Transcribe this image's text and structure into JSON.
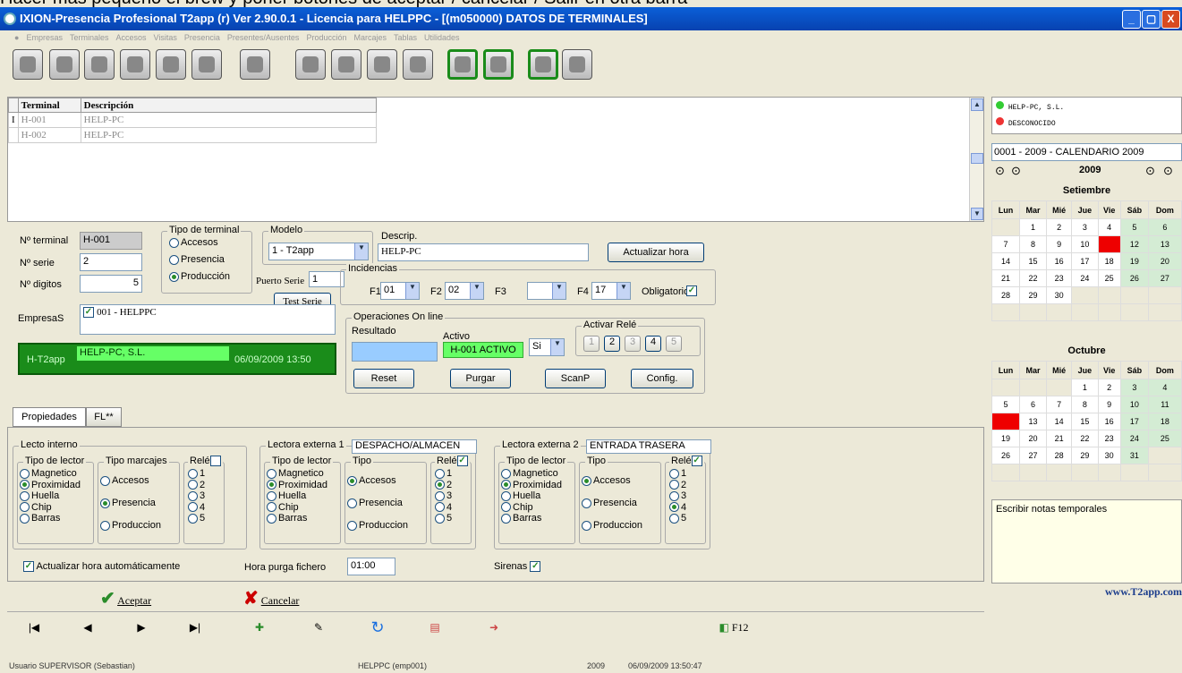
{
  "top_note": "Hacer más pequeño el brew y poner botones de aceptar / cancelar / Salir en otra barra",
  "window": {
    "title": "IXION-Presencia Profesional T2app (r) Ver 2.90.0.1  -  Licencia para HELPPC - [(m050000)  DATOS DE TERMINALES]",
    "min": "_",
    "max": "▢",
    "close": "X"
  },
  "menu": [
    "Empresas",
    "Terminales",
    "Accesos",
    "Visitas",
    "Presencia",
    "Presentes/Ausentes",
    "Producción",
    "Marcajes",
    "Tablas",
    "Utilidades"
  ],
  "toolbar_icons": [
    "users-icon",
    "keys-icon",
    "tools-icon",
    "settings-gear-icon",
    "calculator-icon",
    "printer-icon",
    "compass-icon",
    "document-search-icon",
    "user-edit-icon",
    "calendar-icon",
    "clock-icon",
    "help-icon",
    "info-icon",
    "notes-icon",
    "power-icon"
  ],
  "grid": {
    "headers": [
      "Terminal",
      "Descripción"
    ],
    "rows": [
      [
        "H-001",
        "HELP-PC"
      ],
      [
        "H-002",
        "HELP-PC"
      ]
    ],
    "row_marker": "I"
  },
  "form": {
    "terminal_label": "Nº terminal",
    "terminal_value": "H-001",
    "serie_label": "Nº serie",
    "serie_value": "2",
    "digitos_label": "Nº digitos",
    "digitos_value": "5",
    "empresas_label": "EmpresaS",
    "empresa_item": "001 - HELPPC",
    "tipo_terminal": {
      "title": "Tipo de terminal",
      "options": [
        "Accesos",
        "Presencia",
        "Producción"
      ],
      "selected": 2
    },
    "modelo": {
      "title": "Modelo",
      "value": "1 - T2app"
    },
    "puerto_label": "Puerto Serie",
    "puerto_value": "1",
    "test_serie": "Test Serie",
    "descrip_label": "Descrip.",
    "descrip_value": "HELP-PC",
    "actualizar_hora": "Actualizar hora",
    "incidencias": {
      "title": "Incidencias",
      "f1_label": "F1",
      "f1": "01",
      "f2_label": "F2",
      "f2": "02",
      "f3_label": "F3",
      "f3": "",
      "f4_label": "F4",
      "f4": "17",
      "obligatorio": "Obligatorio"
    },
    "banner": {
      "left": "H-T2app",
      "name": "HELP-PC, S.L.",
      "date": "06/09/2009 13:50"
    },
    "operaciones": {
      "title": "Operaciones On line",
      "resultado": "Resultado",
      "activo_label": "Activo",
      "activo_value": "H-001 ACTIVO",
      "si": "Si",
      "rele_title": "Activar Relé",
      "reles": [
        "1",
        "2",
        "3",
        "4",
        "5"
      ],
      "buttons": [
        "Reset",
        "Purgar",
        "ScanP",
        "Config."
      ]
    }
  },
  "tabs": [
    "Propiedades",
    "FL**"
  ],
  "lecto_interno": {
    "title": "Lecto interno",
    "tipo_lector": "Tipo de lector",
    "lector_opts": [
      "Magnetico",
      "Proximidad",
      "Huella",
      "Chip",
      "Barras"
    ],
    "lector_sel": 1,
    "tipo_marcajes": "Tipo marcajes",
    "marc_opts": [
      "Accesos",
      "Presencia",
      "Produccion"
    ],
    "marc_sel": 1,
    "rele": "Relé",
    "rele_opts": [
      "1",
      "2",
      "3",
      "4",
      "5"
    ],
    "rele_sel": -1
  },
  "lectora1": {
    "title": "Lectora externa 1",
    "name": "DESPACHO/ALMACEN",
    "tipo_lector": "Tipo de lector",
    "lector_opts": [
      "Magnetico",
      "Proximidad",
      "Huella",
      "Chip",
      "Barras"
    ],
    "lector_sel": 1,
    "tipo": "Tipo",
    "marc_opts": [
      "Accesos",
      "Presencia",
      "Produccion"
    ],
    "marc_sel": 0,
    "rele": "Relé",
    "rele_opts": [
      "1",
      "2",
      "3",
      "4",
      "5"
    ],
    "rele_sel": 1
  },
  "lectora2": {
    "title": "Lectora externa 2",
    "name": "ENTRADA TRASERA",
    "tipo_lector": "Tipo de lector",
    "lector_opts": [
      "Magnetico",
      "Proximidad",
      "Huella",
      "Chip",
      "Barras"
    ],
    "lector_sel": 1,
    "tipo": "Tipo",
    "marc_opts": [
      "Accesos",
      "Presencia",
      "Produccion"
    ],
    "marc_sel": 0,
    "rele": "Relé",
    "rele_opts": [
      "1",
      "2",
      "3",
      "4",
      "5"
    ],
    "rele_sel": 3
  },
  "bottom_opts": {
    "actualizar": "Actualizar hora automáticamente",
    "hora_purga_label": "Hora purga fichero",
    "hora_purga": "01:00",
    "sirenas": "Sirenas"
  },
  "actions": {
    "aceptar": "Aceptar",
    "cancelar": "Cancelar"
  },
  "nav": {
    "first": "|◀",
    "prev": "◀",
    "next": "▶",
    "last": "▶|",
    "f12": "F12"
  },
  "status": {
    "user": "Usuario SUPERVISOR (Sebastian)",
    "host": "HELPPC  (emp001)",
    "year": "2009",
    "datetime": "06/09/2009 13:50:47"
  },
  "right": {
    "companies": [
      "HELP-PC, S.L.",
      "DESCONOCIDO"
    ],
    "calendar_select": "0001 - 2009 - CALENDARIO 2009",
    "year": "2009",
    "weekdays": [
      "Lun",
      "Mar",
      "Mié",
      "Jue",
      "Vie",
      "Sáb",
      "Dom"
    ],
    "months": [
      {
        "name": "Setiembre",
        "weeks": [
          [
            "",
            "1",
            "2",
            "3",
            "4",
            "5",
            "6"
          ],
          [
            "7",
            "8",
            "9",
            "10",
            "11",
            "12",
            "13"
          ],
          [
            "14",
            "15",
            "16",
            "17",
            "18",
            "19",
            "20"
          ],
          [
            "21",
            "22",
            "23",
            "24",
            "25",
            "26",
            "27"
          ],
          [
            "28",
            "29",
            "30",
            "",
            "",
            "",
            ""
          ],
          [
            "",
            "",
            "",
            "",
            "",
            "",
            ""
          ]
        ],
        "red": [
          "11"
        ]
      },
      {
        "name": "Octubre",
        "weeks": [
          [
            "",
            "",
            "",
            "1",
            "2",
            "3",
            "4"
          ],
          [
            "5",
            "6",
            "7",
            "8",
            "9",
            "10",
            "11"
          ],
          [
            "12",
            "13",
            "14",
            "15",
            "16",
            "17",
            "18"
          ],
          [
            "19",
            "20",
            "21",
            "22",
            "23",
            "24",
            "25"
          ],
          [
            "26",
            "27",
            "28",
            "29",
            "30",
            "31",
            ""
          ],
          [
            "",
            "",
            "",
            "",
            "",
            "",
            ""
          ]
        ],
        "red": [
          "12"
        ]
      }
    ],
    "notes_placeholder": "Escribir notas temporales",
    "website": "www.T2app.com"
  }
}
